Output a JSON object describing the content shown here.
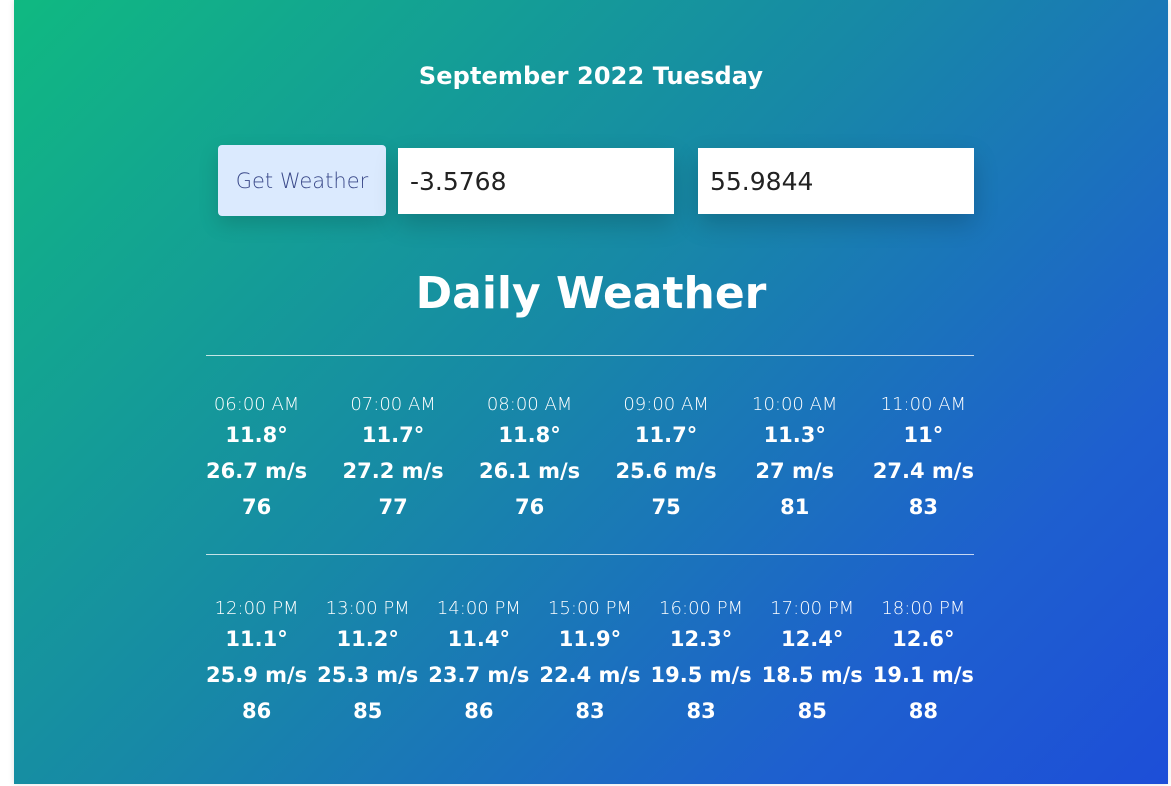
{
  "header": {
    "date_title": "September 2022 Tuesday"
  },
  "controls": {
    "button_label": "Get Weather",
    "longitude_value": "-3.5768",
    "latitude_value": "55.9844"
  },
  "daily": {
    "title": "Daily Weather",
    "rows": [
      [
        {
          "time": "06:00 AM",
          "temp": "11.8°",
          "wind": "26.7 m/s",
          "humidity": "76"
        },
        {
          "time": "07:00 AM",
          "temp": "11.7°",
          "wind": "27.2 m/s",
          "humidity": "77"
        },
        {
          "time": "08:00 AM",
          "temp": "11.8°",
          "wind": "26.1 m/s",
          "humidity": "76"
        },
        {
          "time": "09:00 AM",
          "temp": "11.7°",
          "wind": "25.6 m/s",
          "humidity": "75"
        },
        {
          "time": "10:00 AM",
          "temp": "11.3°",
          "wind": "27 m/s",
          "humidity": "81"
        },
        {
          "time": "11:00 AM",
          "temp": "11°",
          "wind": "27.4 m/s",
          "humidity": "83"
        }
      ],
      [
        {
          "time": "12:00 PM",
          "temp": "11.1°",
          "wind": "25.9 m/s",
          "humidity": "86"
        },
        {
          "time": "13:00 PM",
          "temp": "11.2°",
          "wind": "25.3 m/s",
          "humidity": "85"
        },
        {
          "time": "14:00 PM",
          "temp": "11.4°",
          "wind": "23.7 m/s",
          "humidity": "86"
        },
        {
          "time": "15:00 PM",
          "temp": "11.9°",
          "wind": "22.4 m/s",
          "humidity": "83"
        },
        {
          "time": "16:00 PM",
          "temp": "12.3°",
          "wind": "19.5 m/s",
          "humidity": "83"
        },
        {
          "time": "17:00 PM",
          "temp": "12.4°",
          "wind": "18.5 m/s",
          "humidity": "85"
        },
        {
          "time": "18:00 PM",
          "temp": "12.6°",
          "wind": "19.1 m/s",
          "humidity": "88"
        }
      ]
    ]
  },
  "colors": {
    "gradient_start": "#10b981",
    "gradient_end": "#1d4ed8",
    "button_bg": "#dbeafe",
    "button_text": "#3b4a8a"
  }
}
